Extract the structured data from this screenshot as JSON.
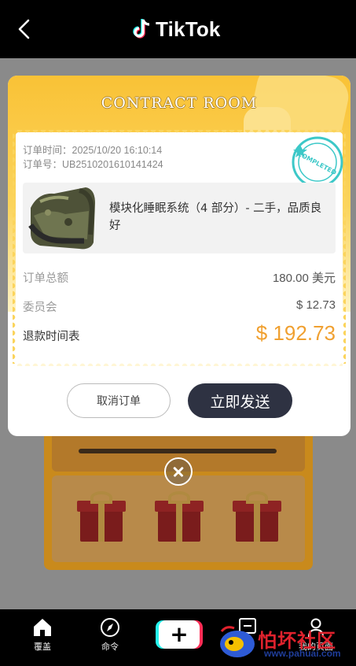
{
  "header": {
    "brand": "TikTok"
  },
  "modal": {
    "title": "CONTRACT ROOM",
    "order_time": "订单时间：2025/10/20 16:10:14",
    "order_number": "订单号：UB2510201610141424",
    "stamp_text": "COMPLETED",
    "product_name": "模块化睡眠系统（4 部分）- 二手，品质良好",
    "rows": {
      "total_label": "订单总额",
      "total_value": "180.00 美元",
      "commission_label": "委员会",
      "commission_value": "$ 12.73",
      "refund_label": "退款时间表",
      "refund_value": "$ 192.73"
    },
    "cancel_button": "取消订单",
    "send_button": "立即发送"
  },
  "tabbar": {
    "home": "覆盖",
    "discover": "命令",
    "inbox": "待",
    "profile": "我的页面"
  },
  "watermark": {
    "name": "怕坏社区",
    "url": "www.pahuai.com"
  },
  "colors": {
    "accent_yellow": "#f9c236",
    "price_orange": "#f0a030",
    "send_button": "#2e3242"
  }
}
